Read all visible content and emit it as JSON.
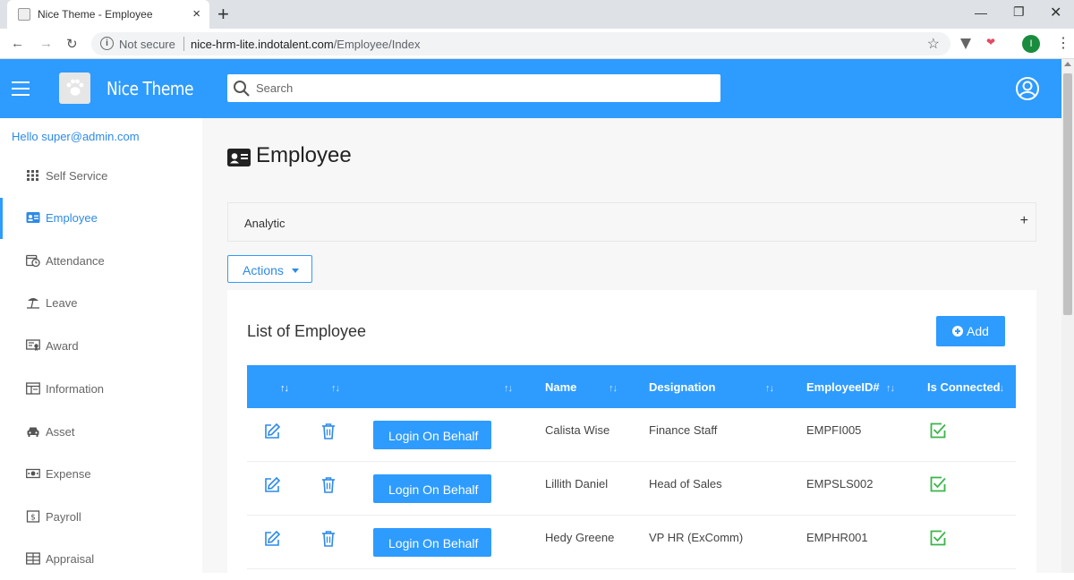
{
  "browser": {
    "tab_title": "Nice Theme - Employee",
    "tab_close": "×",
    "new_tab": "+",
    "not_secure": "Not secure",
    "url_host": "nice-hrm-lite.indotalent.com",
    "url_path": "/Employee/Index",
    "profile_initial": "I"
  },
  "header": {
    "brand": "Nice Theme",
    "search_placeholder": "Search"
  },
  "sidebar": {
    "greeting": "Hello super@admin.com",
    "items": [
      {
        "label": "Self Service",
        "icon": "grid-icon"
      },
      {
        "label": "Employee",
        "icon": "id-card-icon",
        "active": true
      },
      {
        "label": "Attendance",
        "icon": "calendar-clock-icon"
      },
      {
        "label": "Leave",
        "icon": "beach-icon"
      },
      {
        "label": "Award",
        "icon": "certificate-icon"
      },
      {
        "label": "Information",
        "icon": "board-icon"
      },
      {
        "label": "Asset",
        "icon": "car-icon"
      },
      {
        "label": "Expense",
        "icon": "money-icon"
      },
      {
        "label": "Payroll",
        "icon": "dollar-icon"
      },
      {
        "label": "Appraisal",
        "icon": "table-icon"
      }
    ]
  },
  "main": {
    "page_title": "Employee",
    "analytic_label": "Analytic",
    "analytic_toggle": "+",
    "actions_label": "Actions",
    "list_title": "List of Employee",
    "add_label": "Add",
    "columns": [
      "Name",
      "Designation",
      "EmployeeID#",
      "Is Connected"
    ],
    "sort_glyph": "↑↓",
    "login_label": "Login On Behalf",
    "rows": [
      {
        "name": "Calista Wise",
        "designation": "Finance Staff",
        "employee_id": "EMPFI005",
        "connected": true
      },
      {
        "name": "Lillith Daniel",
        "designation": "Head of Sales",
        "employee_id": "EMPSLS002",
        "connected": true
      },
      {
        "name": "Hedy Greene",
        "designation": "VP HR (ExComm)",
        "employee_id": "EMPHR001",
        "connected": true
      }
    ]
  },
  "colors": {
    "primary": "#2e9bff",
    "link": "#2e8ae6",
    "success": "#3bb54a"
  }
}
